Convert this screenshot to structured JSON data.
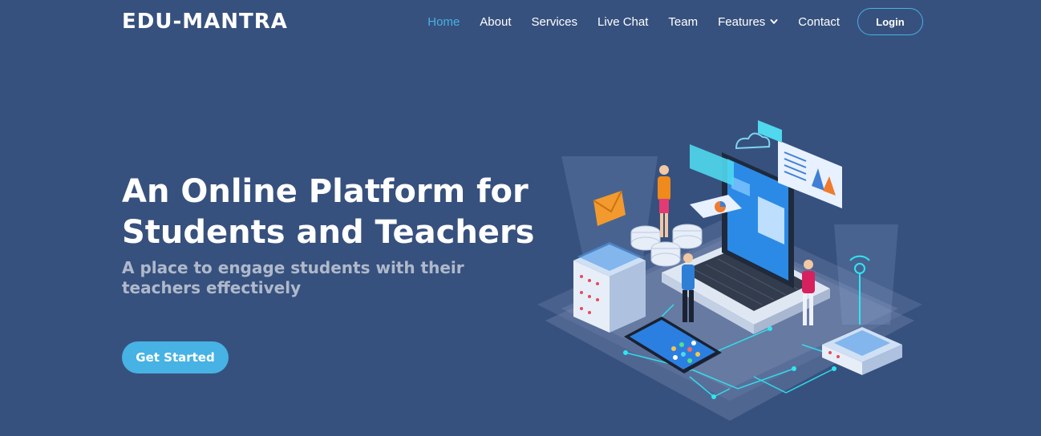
{
  "header": {
    "logo": "EDU-MANTRA",
    "nav": [
      {
        "label": "Home",
        "active": true
      },
      {
        "label": "About"
      },
      {
        "label": "Services"
      },
      {
        "label": "Live Chat"
      },
      {
        "label": "Team"
      },
      {
        "label": "Features",
        "dropdown": true
      },
      {
        "label": "Contact"
      }
    ],
    "login_label": "Login"
  },
  "hero": {
    "title_line1": "An Online Platform for",
    "title_line2": "Students and Teachers",
    "subtitle": "A place to engage students with their teachers effectively",
    "cta_label": "Get Started"
  },
  "colors": {
    "background": "#37517e",
    "accent": "#47b2e4",
    "text": "#ffffff"
  },
  "icons": {
    "dropdown": "chevron-down-icon"
  }
}
